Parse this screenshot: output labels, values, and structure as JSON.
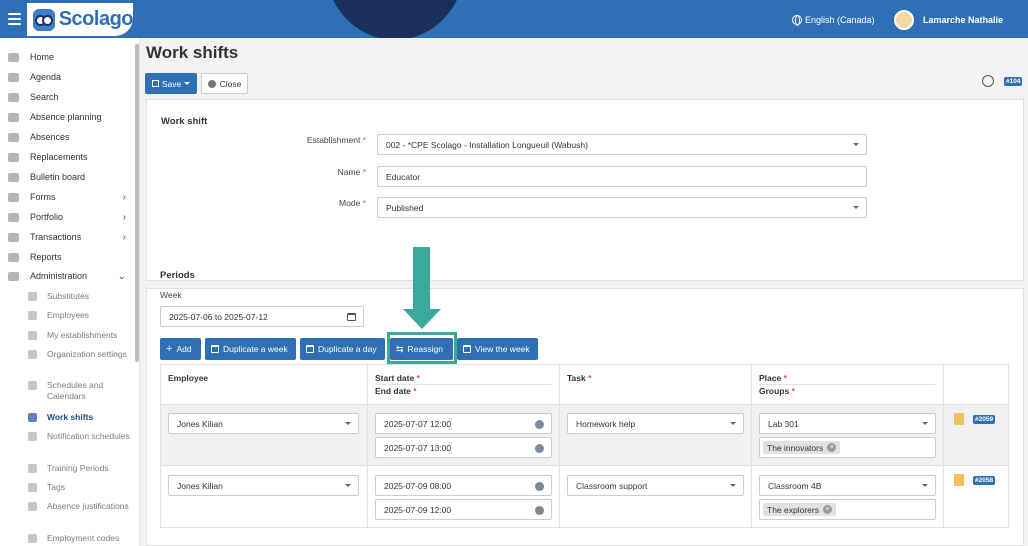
{
  "header": {
    "app_name": "Scolago",
    "language": "English (Canada)",
    "user_name": "Lamarche Nathalie",
    "accent": "#2f6fb5"
  },
  "sidebar": {
    "items": [
      {
        "label": "Home",
        "icon": "home-icon"
      },
      {
        "label": "Agenda",
        "icon": "calendar-icon"
      },
      {
        "label": "Search",
        "icon": "search-icon"
      },
      {
        "label": "Absence planning",
        "icon": "calendar-icon"
      },
      {
        "label": "Absences",
        "icon": "user-absent-icon"
      },
      {
        "label": "Replacements",
        "icon": "replace-icon"
      },
      {
        "label": "Bulletin board",
        "icon": "board-icon"
      },
      {
        "label": "Forms",
        "icon": "form-icon",
        "chevron": "›"
      },
      {
        "label": "Portfolio",
        "icon": "trophy-icon",
        "chevron": "›"
      },
      {
        "label": "Transactions",
        "icon": "card-icon",
        "chevron": "›"
      },
      {
        "label": "Reports",
        "icon": "report-icon"
      },
      {
        "label": "Administration",
        "icon": "gear-icon",
        "chevron": "⌄"
      }
    ],
    "subitems": [
      {
        "label": "Substitutes"
      },
      {
        "label": "Employees"
      },
      {
        "label": "My establishments"
      },
      {
        "label": "Organization settings"
      },
      {
        "label": "Schedules and Calendars"
      },
      {
        "label": "Work shifts",
        "active": true
      },
      {
        "label": "Notification schedules"
      },
      {
        "label": "Training Periods"
      },
      {
        "label": "Tags"
      },
      {
        "label": "Absence justifications"
      },
      {
        "label": "Employment codes"
      }
    ]
  },
  "page": {
    "title": "Work shifts",
    "save_label": "Save",
    "close_label": "Close",
    "record_id": "#104"
  },
  "work_shift": {
    "section_title": "Work shift",
    "establishment_label": "Establishment",
    "establishment_value": "002 - *CPE Scolago - Installation Longueuil (Wabush)",
    "name_label": "Name",
    "name_value": "Educator",
    "mode_label": "Mode",
    "mode_value": "Published",
    "required_mark": "*"
  },
  "periods": {
    "section_title": "Periods",
    "week_label": "Week",
    "week_value": "2025-07-06 to 2025-07-12",
    "buttons": {
      "add": "Add",
      "duplicate_week": "Duplicate a week",
      "duplicate_day": "Duplicate a day",
      "reassign": "Reassign",
      "view_week": "View the week"
    },
    "columns": {
      "employee": "Employee",
      "start_date": "Start date",
      "end_date": "End date",
      "task": "Task",
      "place": "Place",
      "groups": "Groups"
    },
    "rows": [
      {
        "employee": "Jones Kilian",
        "start": "2025-07-07 12:00",
        "end": "2025-07-07 13:00",
        "task": "Homework help",
        "place": "Lab 301",
        "group": "The innovators",
        "id": "#2059"
      },
      {
        "employee": "Jones Kilian",
        "start": "2025-07-09 08:00",
        "end": "2025-07-09 12:00",
        "task": "Classroom support",
        "place": "Classroom 4B",
        "group": "The explorers",
        "id": "#2058"
      }
    ]
  },
  "highlight": {
    "color": "#3aa89a",
    "target": "Reassign"
  }
}
